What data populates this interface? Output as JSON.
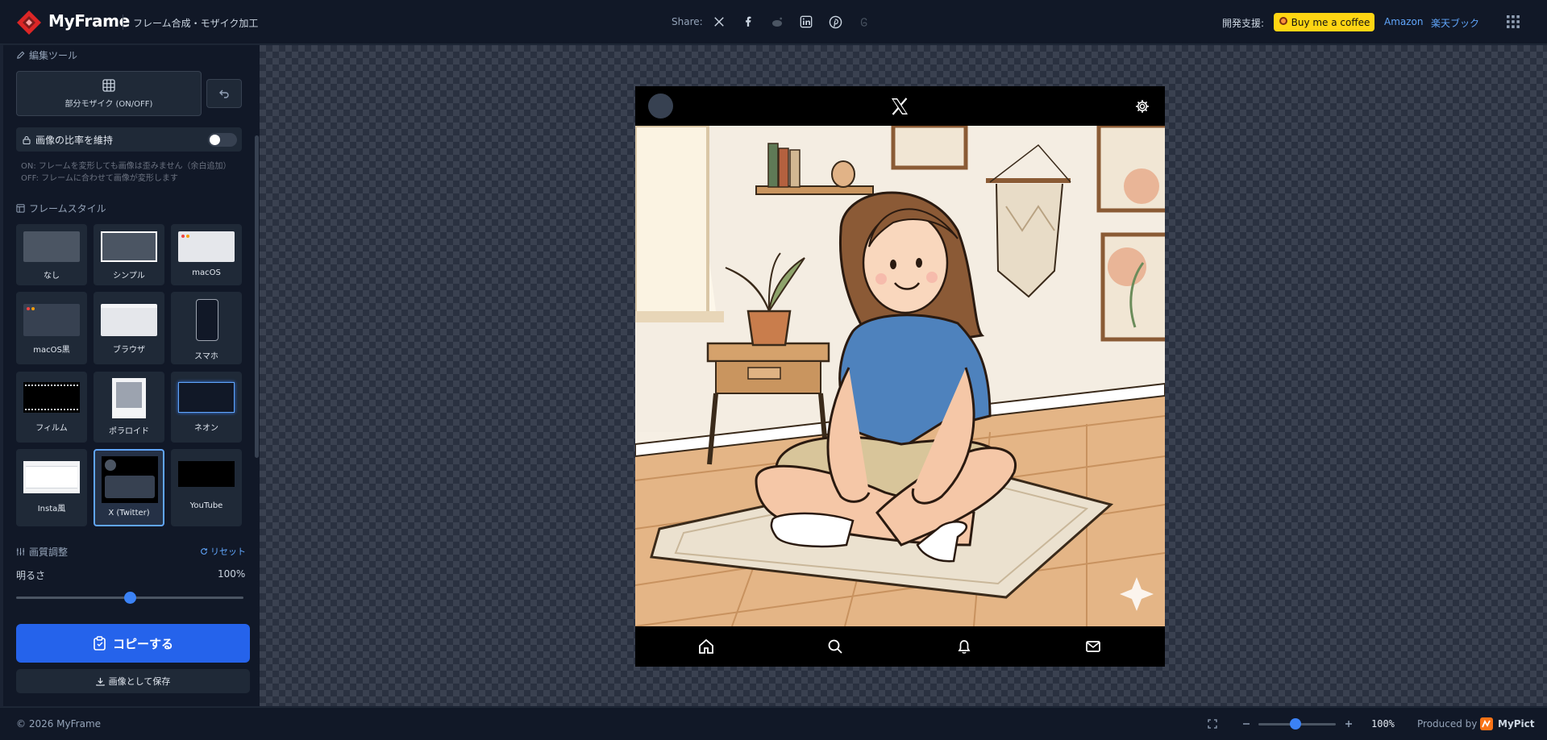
{
  "header": {
    "brand": "MyFrame",
    "subtitle": "フレーム合成・モザイク加工",
    "share_label": "Share:",
    "support_label": "開発支援:",
    "coffee_label": "Buy me a coffee",
    "link_amazon": "Amazon",
    "link_rakuten": "楽天ブック"
  },
  "sidebar": {
    "edit_tools_title": "編集ツール",
    "mosaic_button": "部分モザイク (ON/OFF)",
    "keep_ratio_label": "画像の比率を維持",
    "keep_ratio_on": false,
    "hint_on": "ON: フレームを変形しても画像は歪みません（余白追加）",
    "hint_off": "OFF: フレームに合わせて画像が変形します",
    "frame_style_title": "フレームスタイル",
    "frames": [
      "なし",
      "シンプル",
      "macOS",
      "macOS黒",
      "ブラウザ",
      "スマホ",
      "フィルム",
      "ポラロイド",
      "ネオン",
      "Insta風",
      "X (Twitter)",
      "YouTube"
    ],
    "selected_frame": "X (Twitter)",
    "quality_title": "画質調整",
    "reset_label": "リセット",
    "brightness_label": "明るさ",
    "brightness_value": "100%",
    "brightness_fraction": 0.5,
    "copy_button": "コピーする",
    "save_button": "画像として保存"
  },
  "footer": {
    "copyright": "© 2026 MyFrame",
    "zoom_value": "100%",
    "produced_by": "Produced by",
    "producer": "MyPict"
  },
  "colors": {
    "accent": "#2563eb",
    "link": "#60a5fa",
    "coffee": "#ffd513",
    "logo": "#e11d48"
  }
}
